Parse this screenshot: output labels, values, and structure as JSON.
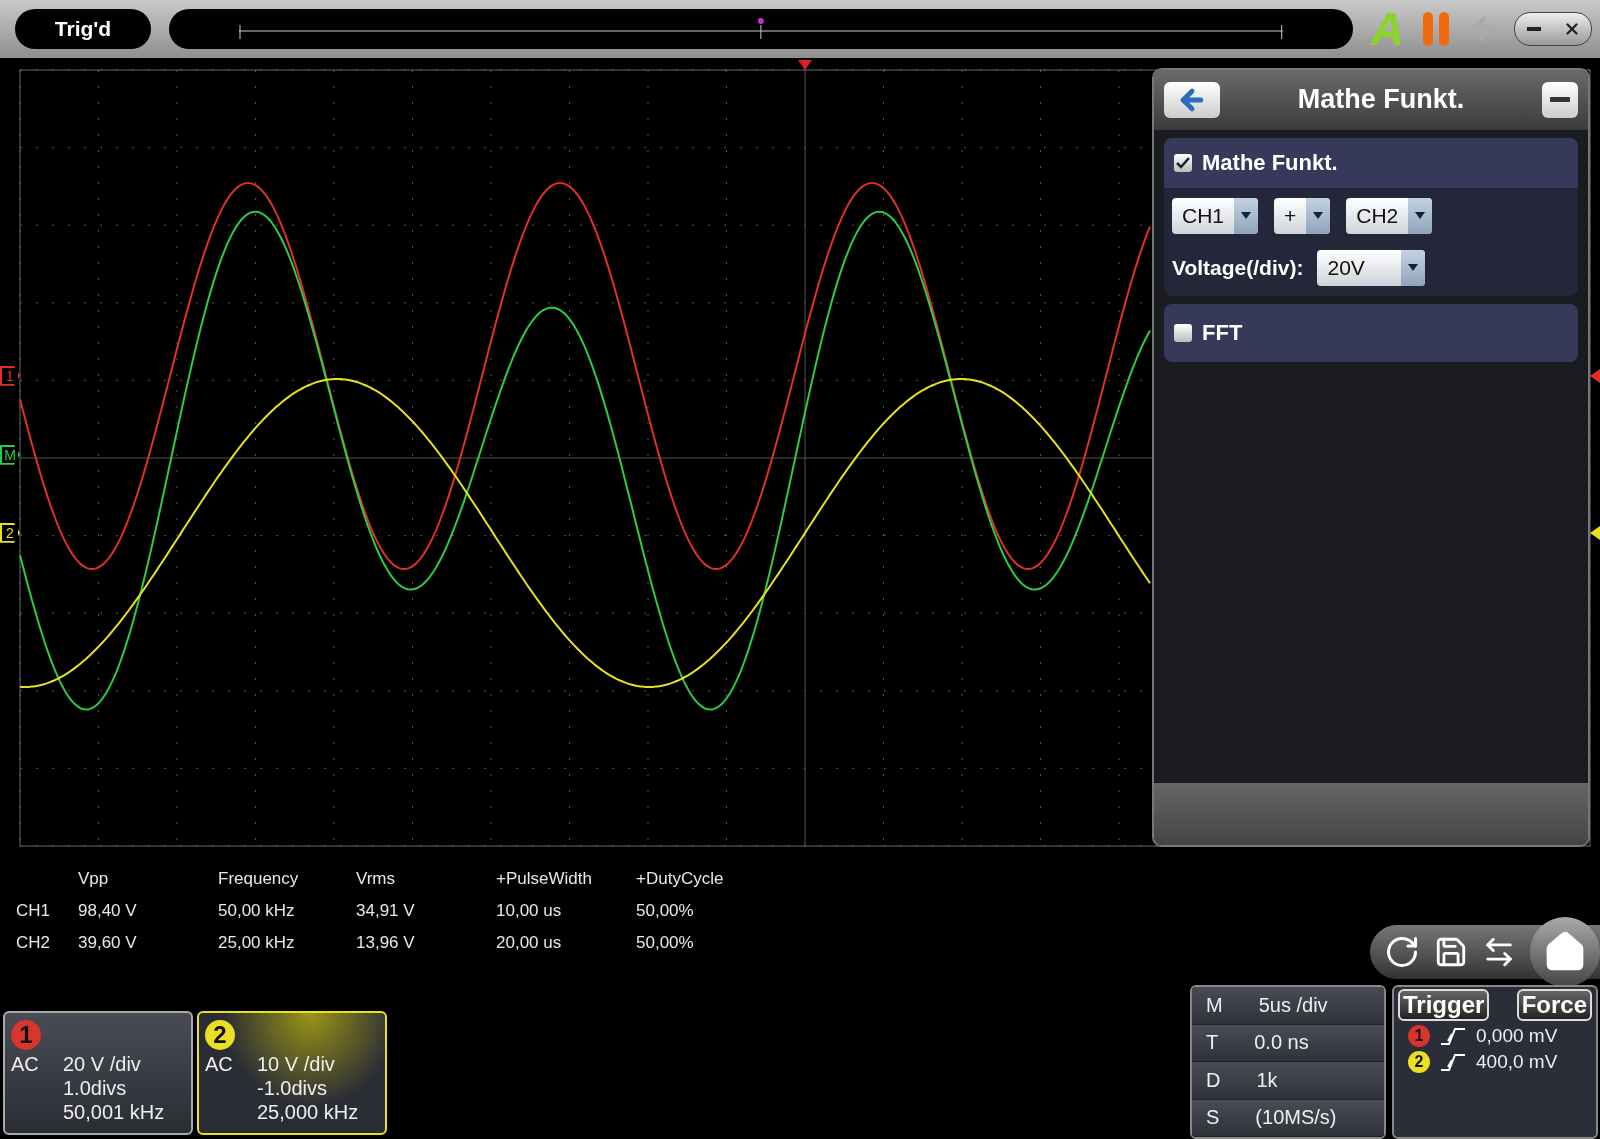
{
  "status": "Trig'd",
  "toolbar": {
    "auto_label": "A"
  },
  "markers": [
    {
      "label": "1",
      "color": "#e0302a"
    },
    {
      "label": "M",
      "color": "#2ecc40"
    },
    {
      "label": "2",
      "color": "#e8e020"
    }
  ],
  "panel": {
    "title": "Mathe Funkt.",
    "math": {
      "label": "Mathe Funkt.",
      "checked": true,
      "source1": "CH1",
      "operator": "+",
      "source2": "CH2",
      "voltage_label": "Voltage(/div):",
      "voltage": "20V"
    },
    "fft": {
      "label": "FFT",
      "checked": false
    }
  },
  "measurements": {
    "columns": [
      "Vpp",
      "Frequency",
      "Vrms",
      "+PulseWidth",
      "+DutyCycle"
    ],
    "rows": [
      {
        "channel": "CH1",
        "values": [
          "98,40 V",
          "50,00 kHz",
          "34,91 V",
          "10,00 us",
          "50,00%"
        ]
      },
      {
        "channel": "CH2",
        "values": [
          "39,60 V",
          "25,00 kHz",
          "13,96 V",
          "20,00 us",
          "50,00%"
        ]
      }
    ]
  },
  "channels": [
    {
      "badge": "1",
      "color": "#d8352c",
      "coupling": "AC",
      "scale": "20 V /div",
      "offset": "1.0divs",
      "frequency": "50,001 kHz",
      "selected": false
    },
    {
      "badge": "2",
      "color": "#e8e020",
      "coupling": "AC",
      "scale": "10 V /div",
      "offset": "-1.0divs",
      "frequency": "25,000 kHz",
      "selected": true
    }
  ],
  "timebase": [
    {
      "key": "M",
      "value": "5us /div"
    },
    {
      "key": "T",
      "value": "0.0 ns"
    },
    {
      "key": "D",
      "value": "1k"
    },
    {
      "key": "S",
      "value": "(10MS/s)"
    }
  ],
  "trigger": {
    "title": "Trigger",
    "force": "Force",
    "sources": [
      {
        "badge": "1",
        "color": "#d8352c",
        "value": "0,000 mV"
      },
      {
        "badge": "2",
        "color": "#e8e020",
        "value": "400,0 mV"
      }
    ]
  }
}
